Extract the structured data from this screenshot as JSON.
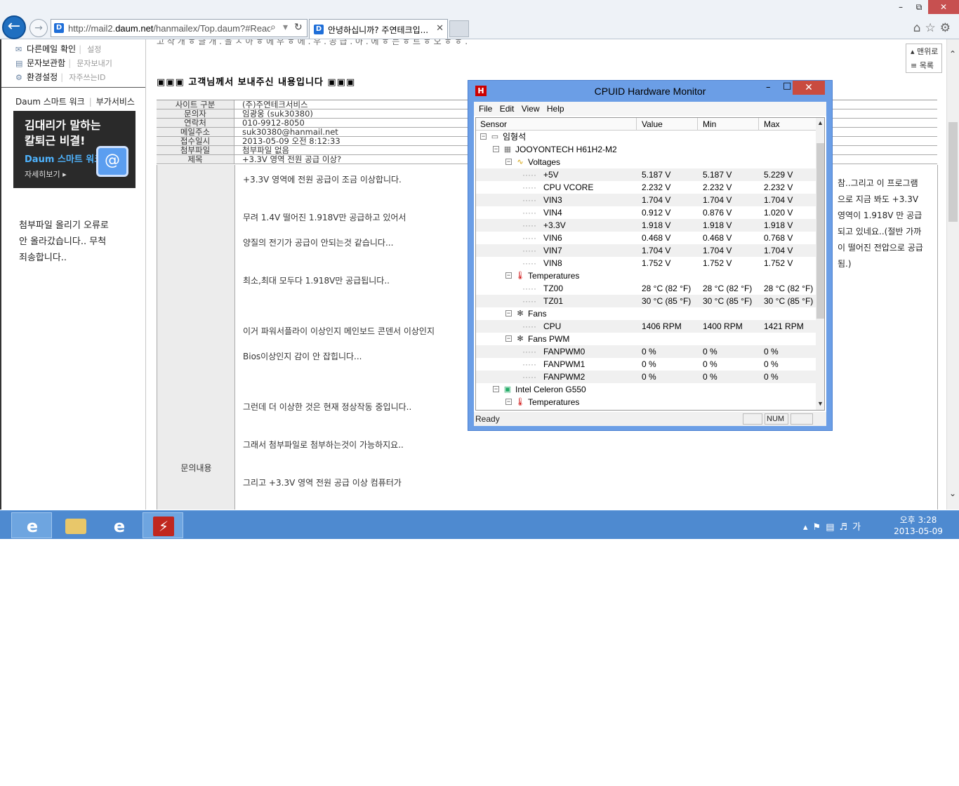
{
  "browser": {
    "url_prefix": "http://mail2.",
    "url_host": "daum.net",
    "url_path": "/hanmailex/Top.daum?#ReadM",
    "tab_title": "안녕하십니까? 주연테크입...",
    "favicon": "D"
  },
  "left": {
    "links": [
      {
        "label": "다른메일 확인",
        "sub": "설정"
      },
      {
        "label": "문자보관함",
        "sub": "문자보내기"
      },
      {
        "label": "환경설정",
        "sub": "자주쓰는ID"
      }
    ],
    "smartwork": "Daum 스마트 워크",
    "addon": "부가서비스",
    "banner_line1": "김대리가 말하는",
    "banner_line2": "칼퇴근 비결!",
    "banner_brand": "Daum 스마트 워크",
    "banner_more": "자세히보기",
    "note": "첨부파일 올리기 오류로 안 올라갔습니다.. 무척 죄송합니다.."
  },
  "mail": {
    "top_cut": "고 작 개 ㅎ 글 개 . 을 ㅅ 아 ㅎ 에 우 ㅎ 에 . 우 . 공 급 . 아 . 에 ㅎ 는 ㅎ 트 ㅎ 오 ㅎ ㅎ .",
    "section_title": "▣▣▣ 고객님께서 보내주신 내용입니다 ▣▣▣",
    "rows": [
      {
        "th": "사이트 구분",
        "td": "(주)주연테크서비스"
      },
      {
        "th": "문의자",
        "td": "임광웅 (suk30380)"
      },
      {
        "th": "연락처",
        "td": "010-9912-8050"
      },
      {
        "th": "메일주소",
        "td": "suk30380@hanmail.net"
      },
      {
        "th": "접수일시",
        "td": "2013-05-09 오전 8:12:33"
      },
      {
        "th": "첨부파일",
        "td": "첨부파일 없음"
      },
      {
        "th": "제목",
        "td": "+3.3V 영역 전원 공급 이상?"
      }
    ],
    "body_th": "문의내용",
    "body_lines": [
      "+3.3V 영역에 전원 공급이 조금 이상합니다.",
      "무려 1.4V 떨어진 1.918V만 공급하고 있어서",
      "양질의 전기가 공급이 안되는것 같습니다...",
      "최소,최대 모두다 1.918V만 공급됩니다..",
      "이거 파워서플라이 이상인지 메인보드 콘덴서 이상인지",
      "Bios이상인지 감이 안 잡힙니다...",
      "그런데 더 이상한 것은 현재 정상작동 중입니다..",
      "그래서 첨부파일로 첨부하는것이 가능하지요..",
      "그리고 +3.3V 영역 전원 공급 이상 컴퓨터가"
    ],
    "right_note": "참..그리고 이 프로그램으로 지금 봐도 +3.3V 영역이 1.918V 만 공급되고 있네요..(절반 가까이 떨어진 전압으로 공급됨.)"
  },
  "float_nav": {
    "top": "맨위로",
    "list": "목록"
  },
  "hwmonitor": {
    "title": "CPUID Hardware Monitor",
    "logo": "H",
    "menu": [
      "File",
      "Edit",
      "View",
      "Help"
    ],
    "columns": [
      "Sensor",
      "Value",
      "Min",
      "Max"
    ],
    "tree": [
      {
        "name": "임형석",
        "level": 0,
        "kind": "computer",
        "expand": "⊟"
      },
      {
        "name": "JOOYONTECH H61H2-M2",
        "level": 1,
        "kind": "board",
        "expand": "⊟"
      },
      {
        "name": "Voltages",
        "level": 2,
        "kind": "volt",
        "expand": "⊟"
      },
      {
        "name": "+5V",
        "level": 3,
        "value": "5.187 V",
        "min": "5.187 V",
        "max": "5.229 V"
      },
      {
        "name": "CPU VCORE",
        "level": 3,
        "value": "2.232 V",
        "min": "2.232 V",
        "max": "2.232 V"
      },
      {
        "name": "VIN3",
        "level": 3,
        "value": "1.704 V",
        "min": "1.704 V",
        "max": "1.704 V"
      },
      {
        "name": "VIN4",
        "level": 3,
        "value": "0.912 V",
        "min": "0.876 V",
        "max": "1.020 V"
      },
      {
        "name": "+3.3V",
        "level": 3,
        "value": "1.918 V",
        "min": "1.918 V",
        "max": "1.918 V"
      },
      {
        "name": "VIN6",
        "level": 3,
        "value": "0.468 V",
        "min": "0.468 V",
        "max": "0.768 V"
      },
      {
        "name": "VIN7",
        "level": 3,
        "value": "1.704 V",
        "min": "1.704 V",
        "max": "1.704 V"
      },
      {
        "name": "VIN8",
        "level": 3,
        "value": "1.752 V",
        "min": "1.752 V",
        "max": "1.752 V"
      },
      {
        "name": "Temperatures",
        "level": 2,
        "kind": "temp",
        "expand": "⊟"
      },
      {
        "name": "TZ00",
        "level": 3,
        "value": "28 °C  (82 °F)",
        "min": "28 °C  (82 °F)",
        "max": "28 °C  (82 °F)"
      },
      {
        "name": "TZ01",
        "level": 3,
        "value": "30 °C  (85 °F)",
        "min": "30 °C  (85 °F)",
        "max": "30 °C  (85 °F)"
      },
      {
        "name": "Fans",
        "level": 2,
        "kind": "fan",
        "expand": "⊟"
      },
      {
        "name": "CPU",
        "level": 3,
        "value": "1406 RPM",
        "min": "1400 RPM",
        "max": "1421 RPM"
      },
      {
        "name": "Fans PWM",
        "level": 2,
        "kind": "fan",
        "expand": "⊟"
      },
      {
        "name": "FANPWM0",
        "level": 3,
        "value": "0 %",
        "min": "0 %",
        "max": "0 %"
      },
      {
        "name": "FANPWM1",
        "level": 3,
        "value": "0 %",
        "min": "0 %",
        "max": "0 %"
      },
      {
        "name": "FANPWM2",
        "level": 3,
        "value": "0 %",
        "min": "0 %",
        "max": "0 %"
      },
      {
        "name": "Intel Celeron G550",
        "level": 1,
        "kind": "chip",
        "expand": "⊟"
      },
      {
        "name": "Temperatures",
        "level": 2,
        "kind": "temp",
        "expand": "⊟"
      }
    ],
    "status": "Ready",
    "status_num": "NUM"
  },
  "taskbar": {
    "clock_time": "오후 3:28",
    "clock_date": "2013-05-09",
    "ime": "가"
  },
  "colors": {
    "taskbar": "#4e8ad0",
    "hwm_frame": "#6b9ee6",
    "close_red": "#c94b3f"
  }
}
